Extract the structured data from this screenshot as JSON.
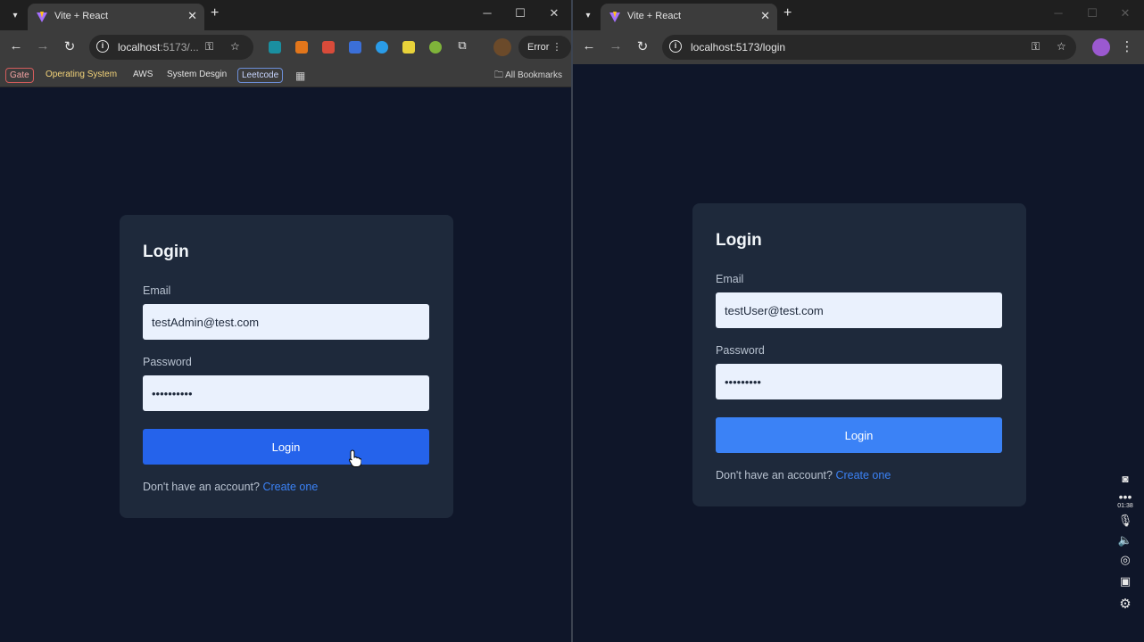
{
  "left": {
    "tab_title": "Vite + React",
    "url_host": "localhost",
    "url_rest": ":5173/...",
    "error_label": "Error",
    "bookmarks": [
      "Gate",
      "Operating System",
      "AWS",
      "System Desgin",
      "Leetcode"
    ],
    "all_bookmarks": "All Bookmarks",
    "form": {
      "title": "Login",
      "email_label": "Email",
      "email_value": "testAdmin@test.com",
      "password_label": "Password",
      "password_value": "••••••••••",
      "button_label": "Login",
      "signup_text": "Don't have an account?",
      "signup_link": "Create one"
    },
    "colors": {
      "button": "#2563eb"
    }
  },
  "right": {
    "tab_title": "Vite + React",
    "url_host": "localhost",
    "url_rest": ":5173/login",
    "form": {
      "title": "Login",
      "email_label": "Email",
      "email_value": "testUser@test.com",
      "password_label": "Password",
      "password_value": "•••••••••",
      "button_label": "Login",
      "signup_text": "Don't have an account?",
      "signup_link": "Create one"
    },
    "colors": {
      "button": "#3b82f6"
    }
  },
  "recorder": {
    "timer": "01:38",
    "icons": [
      "camera-icon",
      "more-icon",
      "microphone-icon",
      "speaker-icon",
      "webcam-icon",
      "window-icon",
      "settings-icon"
    ]
  }
}
